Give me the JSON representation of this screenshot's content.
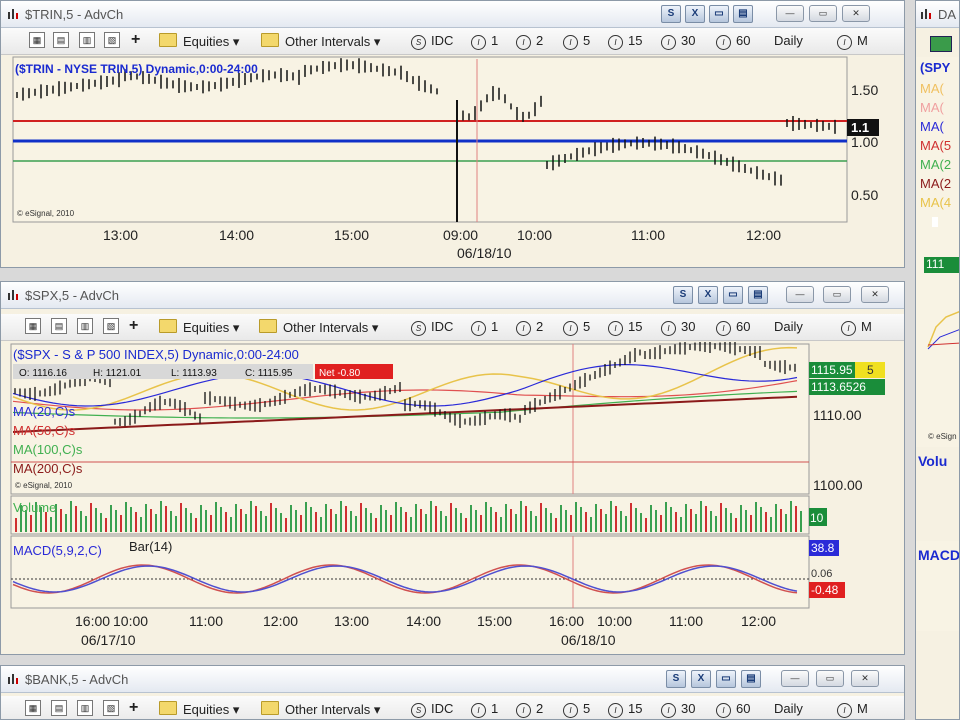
{
  "toolbar": {
    "equities": "Equities",
    "other_intervals": "Other Intervals",
    "idc": "IDC",
    "i1": "1",
    "i2": "2",
    "i5": "5",
    "i15": "15",
    "i30": "30",
    "i60": "60",
    "daily": "Daily",
    "m": "M"
  },
  "trin": {
    "title": "$TRIN,5 - AdvCh",
    "symbol_line": "($TRIN - NYSE TRIN,5) Dynamic,0:00-24:00",
    "copyright": "© eSignal, 2010",
    "price_labels": [
      "1.50",
      "1.00",
      "0.50"
    ],
    "last": "1.1",
    "times": [
      "13:00",
      "14:00",
      "15:00",
      "09:00",
      "10:00",
      "11:00",
      "12:00"
    ],
    "date": "06/18/10"
  },
  "spx": {
    "title": "$SPX,5 - AdvCh",
    "symbol_line": "($SPX - S & P 500 INDEX,5) Dynamic,0:00-24:00",
    "ohlc": {
      "o": "O: 1116.16",
      "h": "H: 1121.01",
      "l": "L: 1113.93",
      "c": "C: 1115.95",
      "net": "Net -0.80"
    },
    "ma_labels": [
      "MA(20,C)s",
      "MA(50,C)s",
      "MA(100,C)s",
      "MA(200,C)s"
    ],
    "copyright": "© eSignal, 2010",
    "price_labels": [
      "1110.00",
      "1100.00"
    ],
    "tag1": "1115.95",
    "tag1b": "5",
    "tag2": "1113.6526",
    "volume_label": "Volume",
    "volume_tag": "10",
    "macd_label": "MACD(5,9,2,C)",
    "bar_label": "Bar(14)",
    "macd_tag1": "38.8",
    "macd_tag2": "0.06",
    "macd_tag3": "-0.48",
    "times": [
      "16:00",
      "10:00",
      "11:00",
      "12:00",
      "13:00",
      "14:00",
      "15:00",
      "16:00",
      "10:00",
      "11:00",
      "12:00"
    ],
    "date1": "06/17/10",
    "date2": "06/18/10"
  },
  "bank": {
    "title": "$BANK,5 - AdvCh"
  },
  "right_panel": {
    "title": "DA",
    "symbol": "(SPY",
    "ma_labels": [
      "MA(",
      "MA(",
      "MA(",
      "MA(5",
      "MA(2",
      "MA(2",
      "MA(4"
    ],
    "price_tag": "111",
    "copyright": "© eSign",
    "volume": "Volu",
    "macd": "MACD"
  },
  "colors": {
    "blue_line": "#1030c8",
    "red_line": "#d02020",
    "green_line": "#3aa050",
    "ma20": "#2a2ad8",
    "ma50": "#e05050",
    "ma100": "#40b050",
    "ma200": "#8b1a1a",
    "ma_yellow": "#e8c34a"
  }
}
